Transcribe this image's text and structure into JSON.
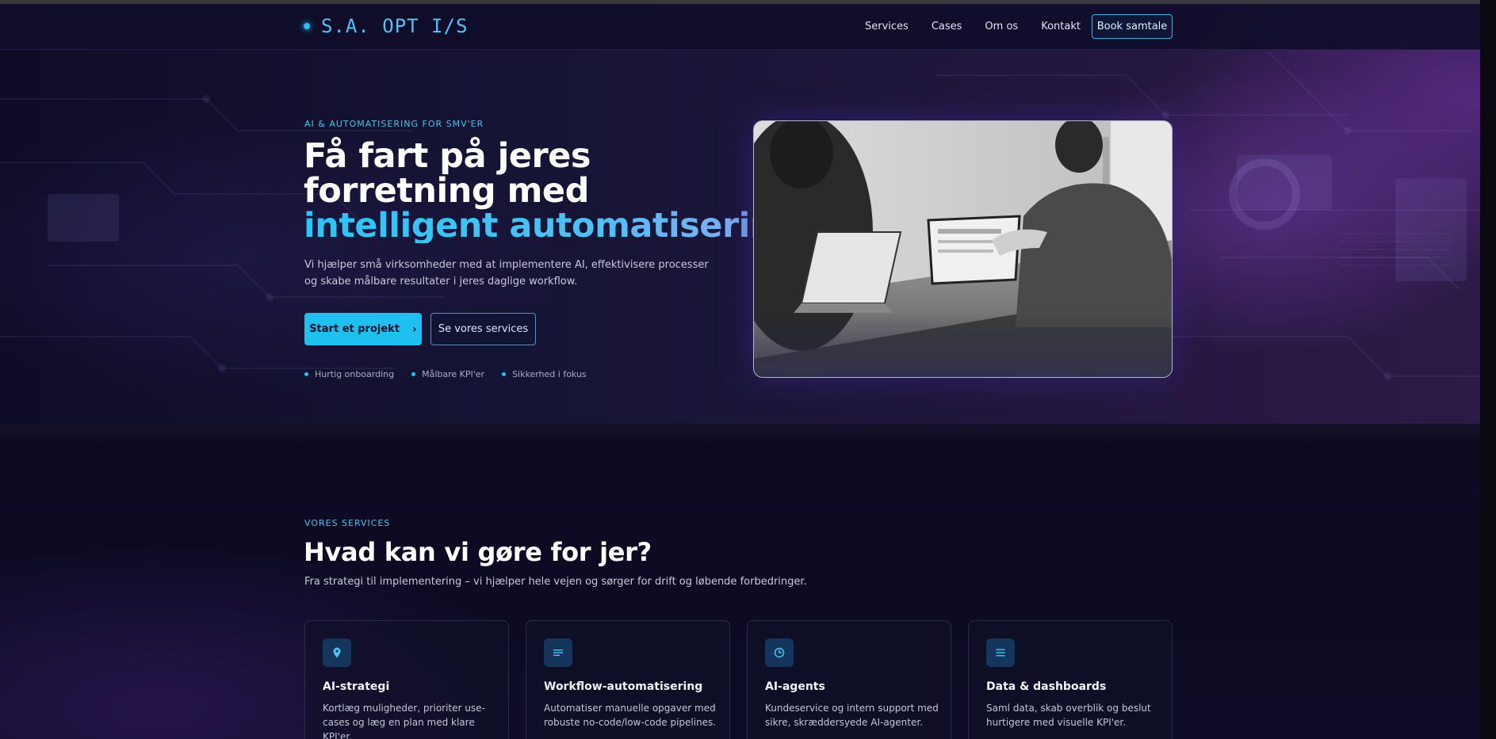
{
  "brand": {
    "name": "S.A. OPT I/S",
    "accent": "#22c4f4"
  },
  "nav": {
    "links": [
      "Services",
      "Cases",
      "Om os",
      "Kontakt"
    ],
    "cta": "Book samtale"
  },
  "hero": {
    "eyebrow": "AI & AUTOMATISERING FOR SMV'ER",
    "title": "Få fart på jeres forretning med",
    "title_accent": "intelligent automatisering",
    "lede": "Vi hjælper små virksomheder med at implementere AI, effektivisere processer og skabe målbare resultater i jeres daglige workflow.",
    "primary_button": "Start et projekt",
    "secondary_button": "Se vores services",
    "bullets": [
      "Hurtig onboarding",
      "Målbare KPI'er",
      "Sikkerhed i fokus"
    ]
  },
  "services": {
    "eyebrow": "VORES SERVICES",
    "title": "Hvad kan vi gøre for jer?",
    "subtitle": "Fra strategi til implementering – vi hjælper hele vejen og sørger for drift og løbende forbedringer.",
    "cards": [
      {
        "icon": "map-pin-icon",
        "title": "AI-strategi",
        "text": "Kortlæg muligheder, prioriter use-cases og læg en plan med klare KPI'er."
      },
      {
        "icon": "lines-icon",
        "title": "Workflow-automatisering",
        "text": "Automatiser manuelle opgaver med robuste no-code/low-code pipelines."
      },
      {
        "icon": "clock-icon",
        "title": "AI-agents",
        "text": "Kundeservice og intern support med sikre, skræddersyede AI-agenter."
      },
      {
        "icon": "menu-icon",
        "title": "Data & dashboards",
        "text": "Saml data, skab overblik og beslut hurtigere med visuelle KPI'er."
      }
    ]
  }
}
